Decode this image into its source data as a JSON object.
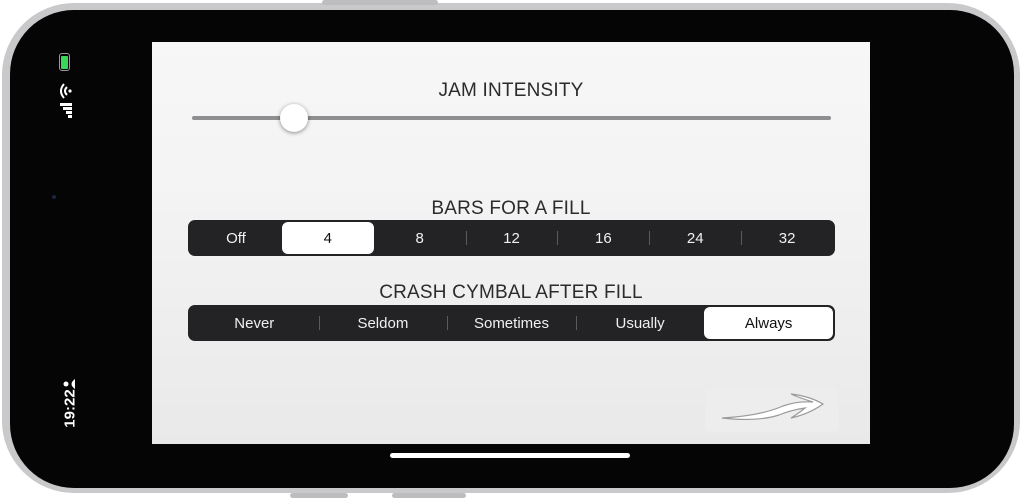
{
  "status_bar": {
    "time": "19:22"
  },
  "screen": {
    "jam_intensity": {
      "label": "JAM INTENSITY",
      "value": 0.16
    },
    "bars_for_fill": {
      "label": "BARS FOR A FILL",
      "options": [
        "Off",
        "4",
        "8",
        "12",
        "16",
        "24",
        "32"
      ],
      "selected_index": 1
    },
    "crash_cymbal": {
      "label": "CRASH CYMBAL AFTER FILL",
      "options": [
        "Never",
        "Seldom",
        "Sometimes",
        "Usually",
        "Always"
      ],
      "selected_index": 4
    },
    "next_button_icon": "swoosh-arrow-icon"
  },
  "colors": {
    "segment_bg": "#232326",
    "segment_selected": "#ffffff",
    "battery_green": "#3ad75a"
  }
}
